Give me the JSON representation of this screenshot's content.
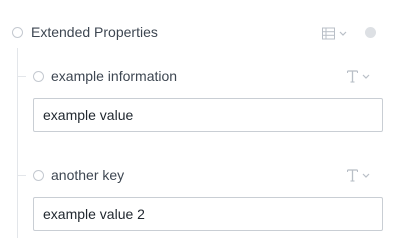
{
  "section": {
    "title": "Extended Properties",
    "icons": {
      "view": "list-icon",
      "chevron": "chevron-down-icon",
      "status": "status-dot-icon"
    }
  },
  "properties": [
    {
      "key": "example information",
      "value": "example value",
      "type_icon": "text-type-icon"
    },
    {
      "key": "another key",
      "value": "example value 2",
      "type_icon": "text-type-icon"
    }
  ],
  "colors": {
    "text": "#3d4651",
    "icon": "#c4c9d0",
    "border": "#c9ced4"
  }
}
